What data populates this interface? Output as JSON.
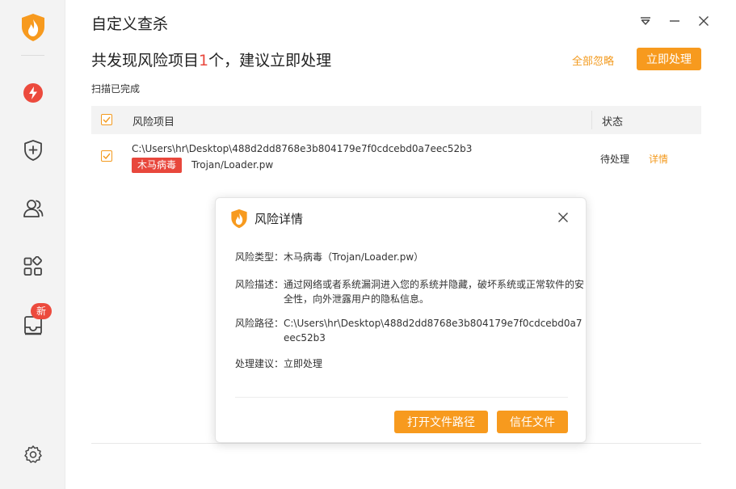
{
  "window": {
    "title": "自定义查杀"
  },
  "sidebar": {
    "badge": "新"
  },
  "header": {
    "headline_prefix": "共发现风险项目",
    "headline_count": "1",
    "headline_suffix": "个，建议立即处理",
    "ignore_all": "全部忽略",
    "fix_now": "立即处理",
    "scan_status": "扫描已完成"
  },
  "table": {
    "columns": [
      "风险项目",
      "状态"
    ],
    "rows": [
      {
        "path": "C:\\Users\\hr\\Desktop\\488d2dd8768e3b804179e7f0cdcebd0a7eec52b3",
        "tag": "木马病毒",
        "name": "Trojan/Loader.pw",
        "status": "待处理",
        "detail": "详情"
      }
    ]
  },
  "dialog": {
    "title": "风险详情",
    "fields": [
      {
        "label": "风险类型：",
        "value": "木马病毒（Trojan/Loader.pw）"
      },
      {
        "label": "风险描述：",
        "value": "通过网络或者系统漏洞进入您的系统并隐藏，破坏系统或正常软件的安全性，向外泄露用户的隐私信息。"
      },
      {
        "label": "风险路径：",
        "value": "C:\\Users\\hr\\Desktop\\488d2dd8768e3b804179e7f0cdcebd0a7eec52b3"
      },
      {
        "label": "处理建议：",
        "value": "立即处理"
      }
    ],
    "open_path_button": "打开文件路径",
    "trust_button": "信任文件"
  },
  "colors": {
    "accent": "#f79a1e",
    "danger": "#e8473c",
    "sidebar_bg": "#f3f3f3"
  }
}
